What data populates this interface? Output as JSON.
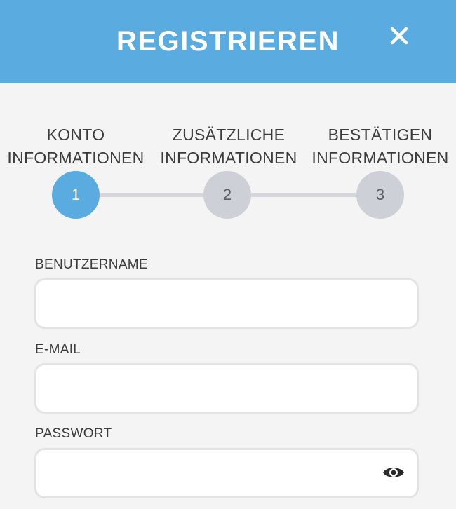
{
  "header": {
    "title": "REGISTRIEREN",
    "close_icon": "close-icon",
    "background_color": "#5aabe0"
  },
  "steps": [
    {
      "line1": "KONTO",
      "line2": "INFORMATIONEN",
      "number": "1",
      "active": true
    },
    {
      "line1": "ZUSÄTZLICHE",
      "line2": "INFORMATIONEN",
      "number": "2",
      "active": false
    },
    {
      "line1": "BESTÄTIGEN",
      "line2": "INFORMATIONEN",
      "number": "3",
      "active": false
    }
  ],
  "form": {
    "username": {
      "label": "BENUTZERNAME",
      "value": "",
      "placeholder": ""
    },
    "email": {
      "label": "E-MAIL",
      "value": "",
      "placeholder": ""
    },
    "password": {
      "label": "PASSWORT",
      "value": "",
      "placeholder": "",
      "toggle_icon": "eye-icon"
    }
  }
}
